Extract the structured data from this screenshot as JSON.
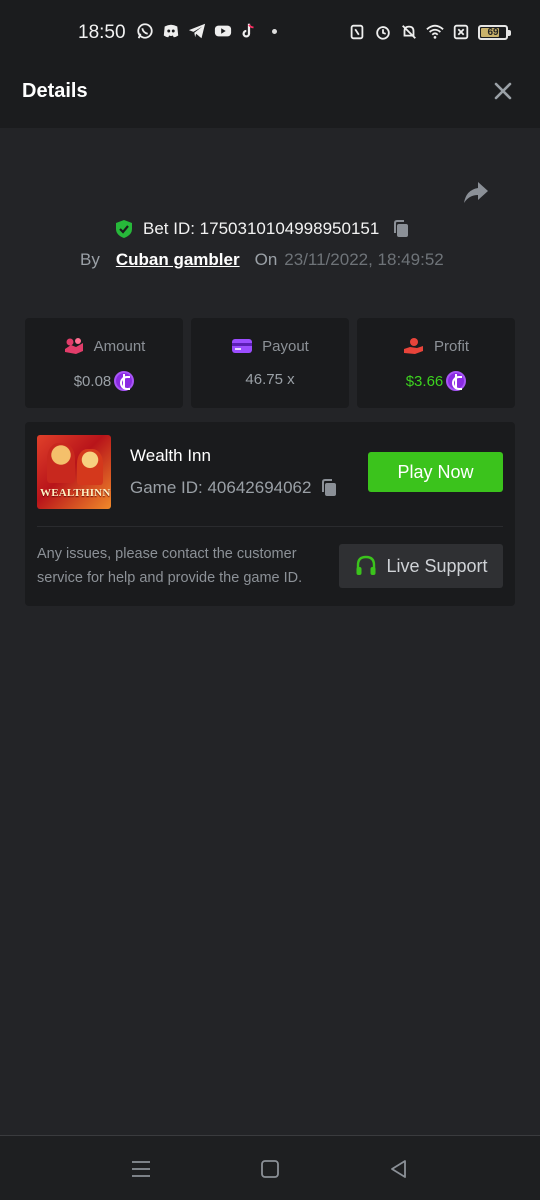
{
  "status_bar": {
    "time": "18:50",
    "left_icons": [
      "whatsapp-icon",
      "discord-icon",
      "telegram-icon",
      "youtube-icon",
      "tiktok-icon",
      "dot-icon"
    ],
    "right_icons": [
      "nfc-icon",
      "alarm-icon",
      "mute-icon",
      "wifi-icon",
      "no-sim-icon",
      "battery-icon"
    ],
    "battery": "69"
  },
  "header": {
    "title": "Details",
    "close_icon": "close-icon"
  },
  "bet": {
    "bet_id_label": "Bet ID: 1750310104998950151",
    "by_label": "By",
    "user": "Cuban gambler",
    "on_label": "On",
    "date": "23/11/2022, 18:49:52"
  },
  "stats": [
    {
      "label": "Amount",
      "value": "$0.08",
      "icon": "amount-icon",
      "has_coin": true
    },
    {
      "label": "Payout",
      "value": "46.75 x",
      "icon": "payout-card-icon",
      "has_coin": false
    },
    {
      "label": "Profit",
      "value": "$3.66",
      "icon": "profit-hand-icon",
      "has_coin": true
    }
  ],
  "game": {
    "name": "Wealth Inn",
    "game_id_label": "Game ID: 40642694062",
    "thumbnail_text": "WEALTHINN",
    "play_label": "Play Now",
    "issue_text": "Any issues, please contact the customer service for help and provide the game ID.",
    "support_label": "Live Support"
  },
  "colors": {
    "accent_green": "#3bc31c",
    "profit_green": "#3cd21f",
    "coin_purple": "#8a2be2",
    "shield_green": "#27b83a"
  }
}
